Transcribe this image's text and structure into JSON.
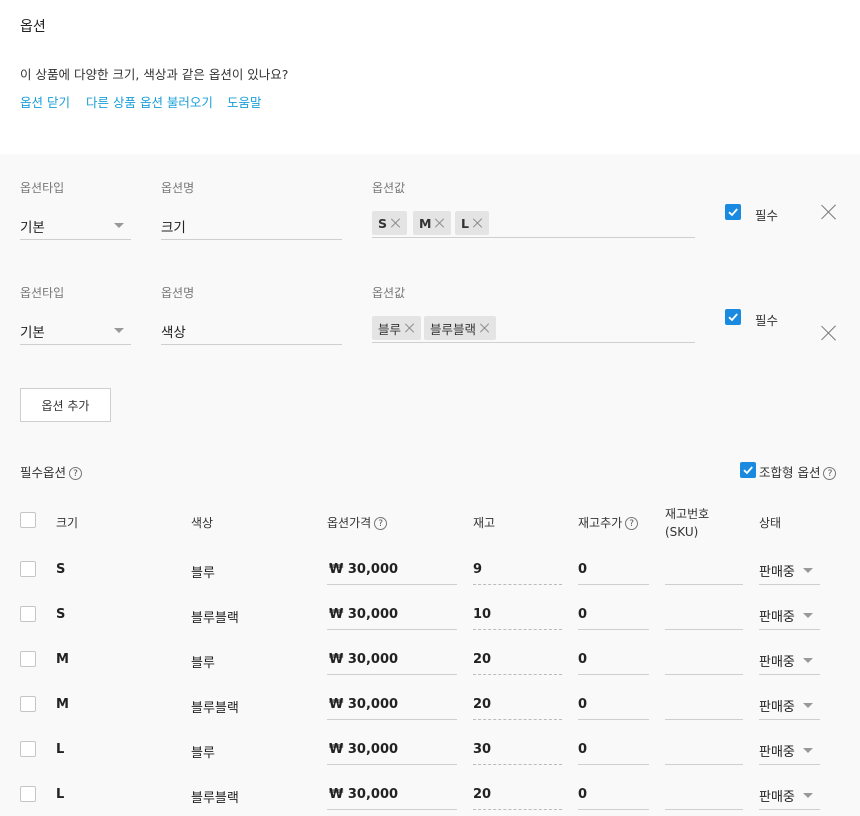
{
  "header": {
    "title": "옵션",
    "question": "이 상품에 다양한 크기, 색상과 같은 옵션이 있나요?",
    "links": [
      "옵션 닫기",
      "다른 상품 옵션 불러오기",
      "도움말"
    ]
  },
  "option_rows": [
    {
      "type_label": "옵션타입",
      "name_label": "옵션명",
      "value_label": "옵션값",
      "type_value": "기본",
      "name_value": "크기",
      "chips": [
        "S",
        "M",
        "L"
      ],
      "required_label": "필수"
    },
    {
      "type_label": "옵션타입",
      "name_label": "옵션명",
      "value_label": "옵션값",
      "type_value": "기본",
      "name_value": "색상",
      "chips": [
        "블루",
        "블루블랙"
      ],
      "required_label": "필수"
    }
  ],
  "add_option_label": "옵션 추가",
  "required_options": {
    "title": "필수옵션",
    "combo_label": "조합형 옵션",
    "help_glyph": "?"
  },
  "table": {
    "headers": {
      "size": "크기",
      "color": "색상",
      "price": "옵션가격",
      "stock": "재고",
      "stock_add": "재고추가",
      "sku_line1": "재고번호",
      "sku_line2": "(SKU)",
      "status": "상태"
    },
    "rows": [
      {
        "size": "S",
        "color": "블루",
        "price": "₩ 30,000",
        "stock": "9",
        "stock_add": "0",
        "sku": "",
        "status": "판매중"
      },
      {
        "size": "S",
        "color": "블루블랙",
        "price": "₩ 30,000",
        "stock": "10",
        "stock_add": "0",
        "sku": "",
        "status": "판매중"
      },
      {
        "size": "M",
        "color": "블루",
        "price": "₩ 30,000",
        "stock": "20",
        "stock_add": "0",
        "sku": "",
        "status": "판매중"
      },
      {
        "size": "M",
        "color": "블루블랙",
        "price": "₩ 30,000",
        "stock": "20",
        "stock_add": "0",
        "sku": "",
        "status": "판매중"
      },
      {
        "size": "L",
        "color": "블루",
        "price": "₩ 30,000",
        "stock": "30",
        "stock_add": "0",
        "sku": "",
        "status": "판매중"
      },
      {
        "size": "L",
        "color": "블루블랙",
        "price": "₩ 30,000",
        "stock": "20",
        "stock_add": "0",
        "sku": "",
        "status": "판매중"
      }
    ]
  },
  "colors": {
    "link": "#1aa0d8",
    "checkbox": "#1a8ae0",
    "section_bg": "#f9f9f9"
  }
}
